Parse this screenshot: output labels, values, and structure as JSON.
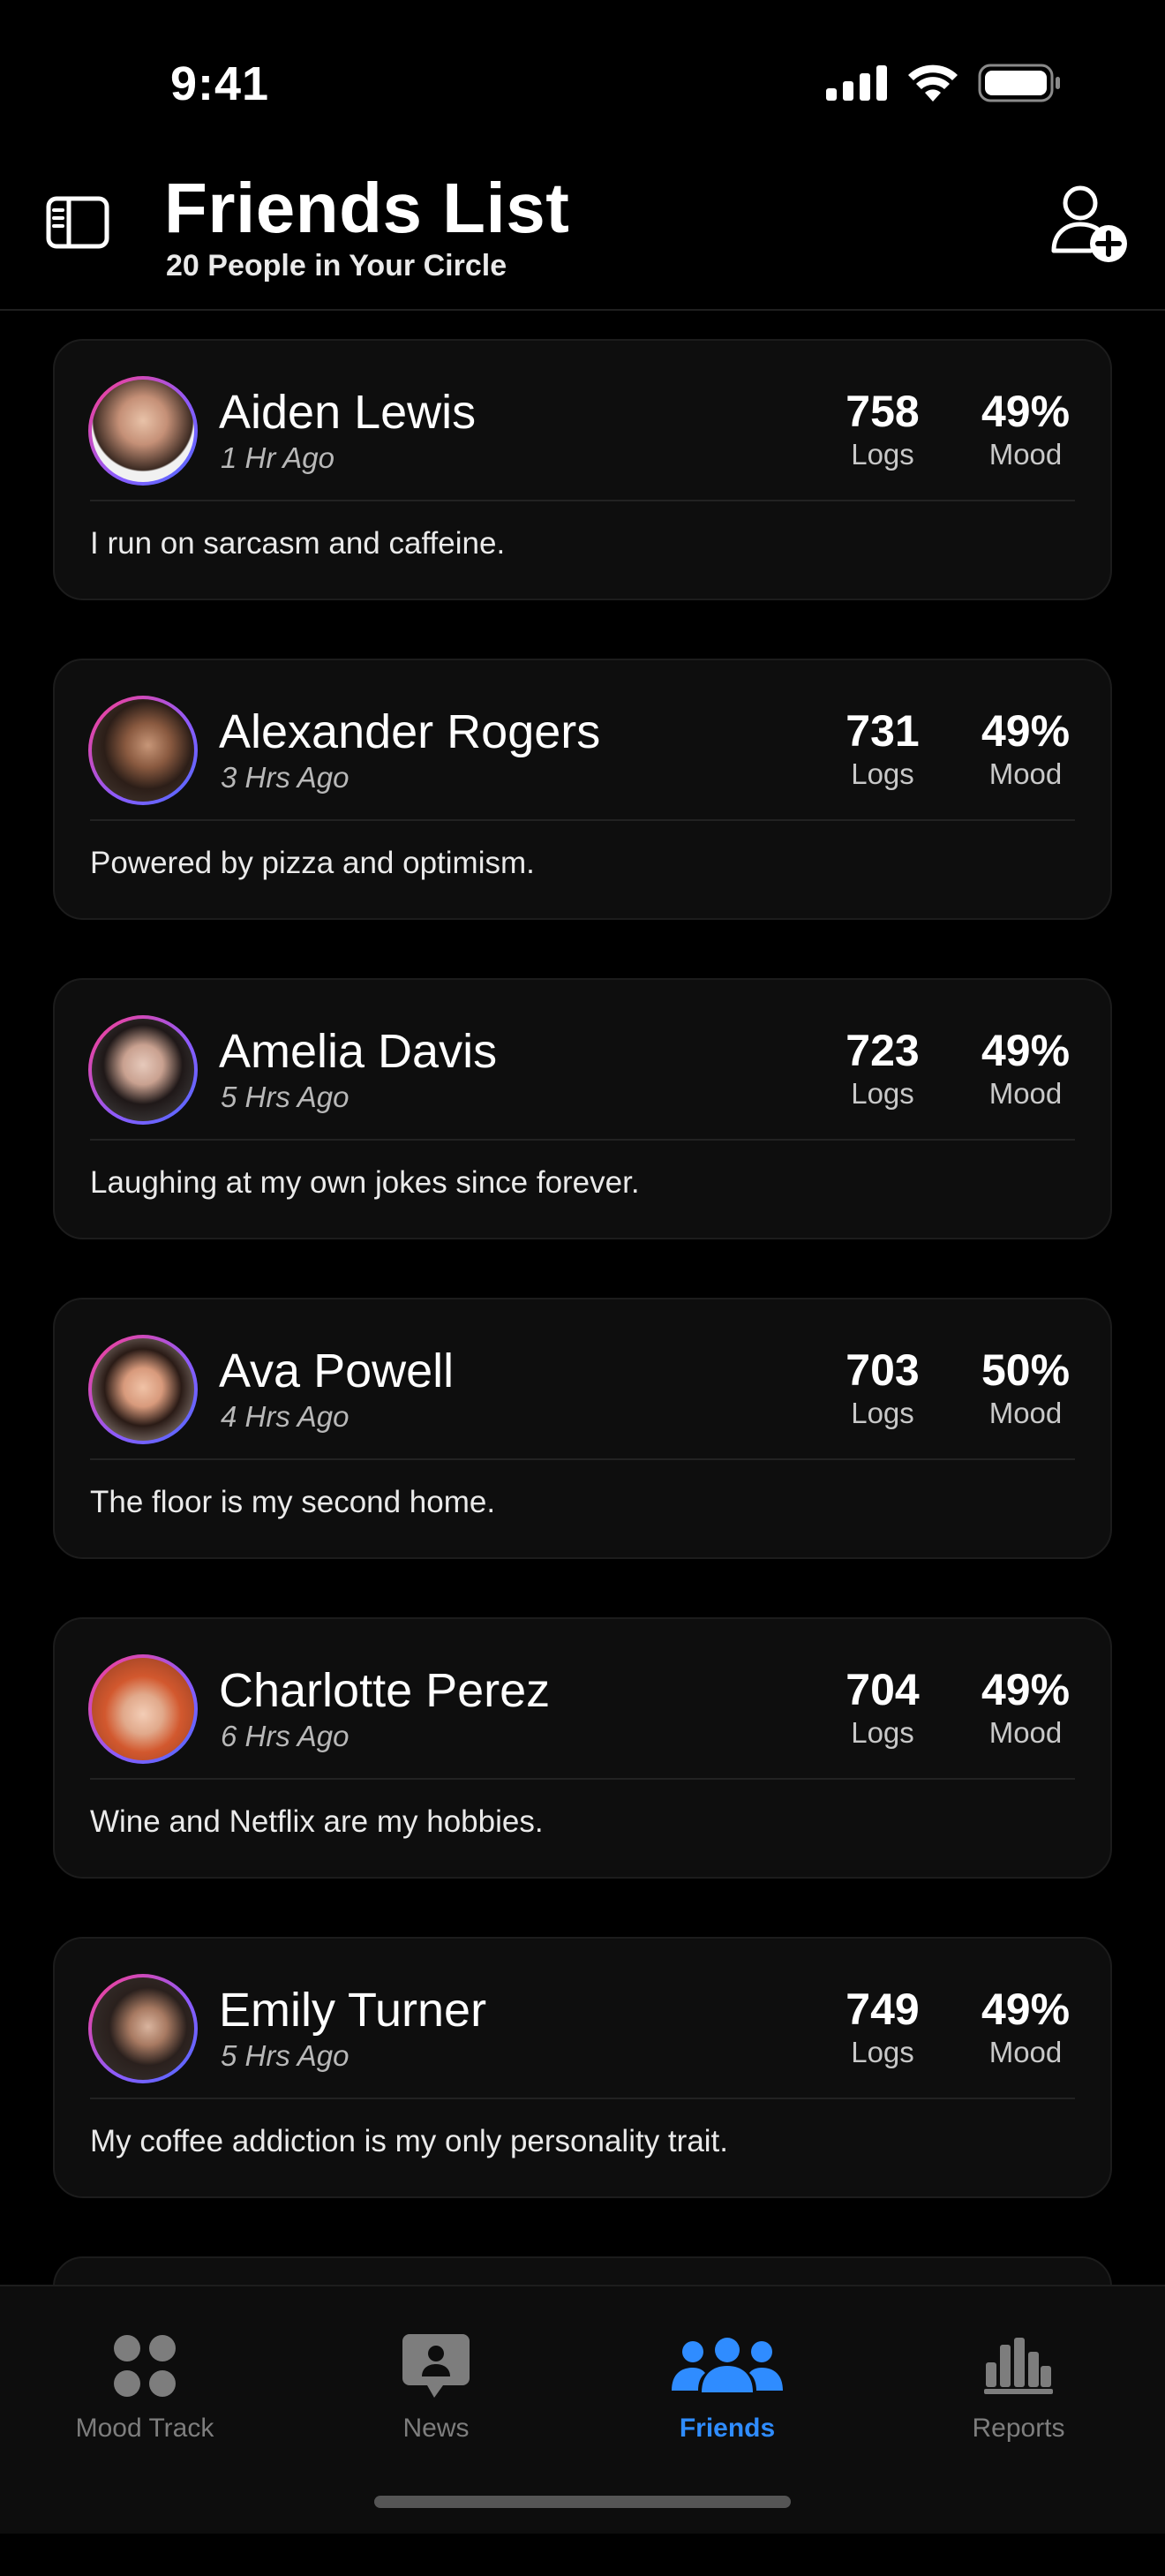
{
  "status_bar": {
    "time": "9:41"
  },
  "header": {
    "title": "Friends List",
    "subtitle": "20 People in Your Circle",
    "sidebar_icon": "sidebar-icon",
    "add_icon": "person-add-icon"
  },
  "friends": [
    {
      "name": "Aiden Lewis",
      "ago": "1 Hr Ago",
      "logs": "758",
      "logs_label": "Logs",
      "mood": "49%",
      "mood_label": "Mood",
      "bio": "I run on sarcasm and caffeine."
    },
    {
      "name": "Alexander Rogers",
      "ago": "3 Hrs Ago",
      "logs": "731",
      "logs_label": "Logs",
      "mood": "49%",
      "mood_label": "Mood",
      "bio": "Powered by pizza and optimism."
    },
    {
      "name": "Amelia Davis",
      "ago": "5 Hrs Ago",
      "logs": "723",
      "logs_label": "Logs",
      "mood": "49%",
      "mood_label": "Mood",
      "bio": "Laughing at my own jokes since forever."
    },
    {
      "name": "Ava Powell",
      "ago": "4 Hrs Ago",
      "logs": "703",
      "logs_label": "Logs",
      "mood": "50%",
      "mood_label": "Mood",
      "bio": "The floor is my second home."
    },
    {
      "name": "Charlotte Perez",
      "ago": "6 Hrs Ago",
      "logs": "704",
      "logs_label": "Logs",
      "mood": "49%",
      "mood_label": "Mood",
      "bio": "Wine and Netflix are my hobbies."
    },
    {
      "name": "Emily Turner",
      "ago": "5 Hrs Ago",
      "logs": "749",
      "logs_label": "Logs",
      "mood": "49%",
      "mood_label": "Mood",
      "bio": "My coffee addiction is my only personality trait."
    }
  ],
  "tabs": [
    {
      "label": "Mood Track",
      "icon": "grid-dots-icon"
    },
    {
      "label": "News",
      "icon": "person-bubble-icon"
    },
    {
      "label": "Friends",
      "icon": "people-icon",
      "active": true
    },
    {
      "label": "Reports",
      "icon": "bar-chart-icon"
    }
  ],
  "colors": {
    "accent": "#2f8cff",
    "background": "#000000",
    "card": "#0e0e0e",
    "avatar_ring_start": "#ff3d8a",
    "avatar_ring_end": "#4c6bff"
  }
}
